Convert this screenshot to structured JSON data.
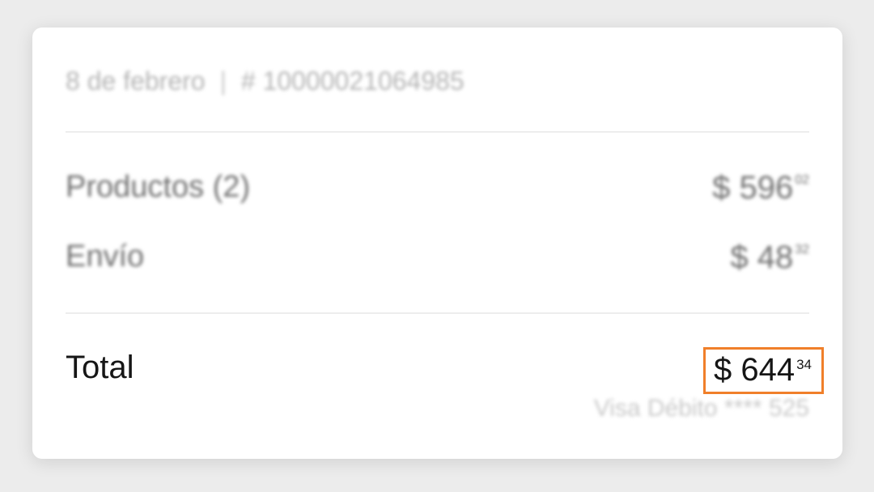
{
  "order": {
    "date": "8 de febrero",
    "separator": "|",
    "number": "# 10000021064985"
  },
  "summary": {
    "products_label": "Productos (2)",
    "products_currency": "$",
    "products_whole": "596",
    "products_cents": "02",
    "shipping_label": "Envío",
    "shipping_currency": "$",
    "shipping_whole": "48",
    "shipping_cents": "32"
  },
  "total": {
    "label": "Total",
    "currency": "$",
    "whole": "644",
    "cents": "34"
  },
  "payment": {
    "method": "Visa Débito **** 525"
  },
  "colors": {
    "highlight_border": "#f07f2a",
    "page_background": "#ececec",
    "card_background": "#ffffff"
  }
}
